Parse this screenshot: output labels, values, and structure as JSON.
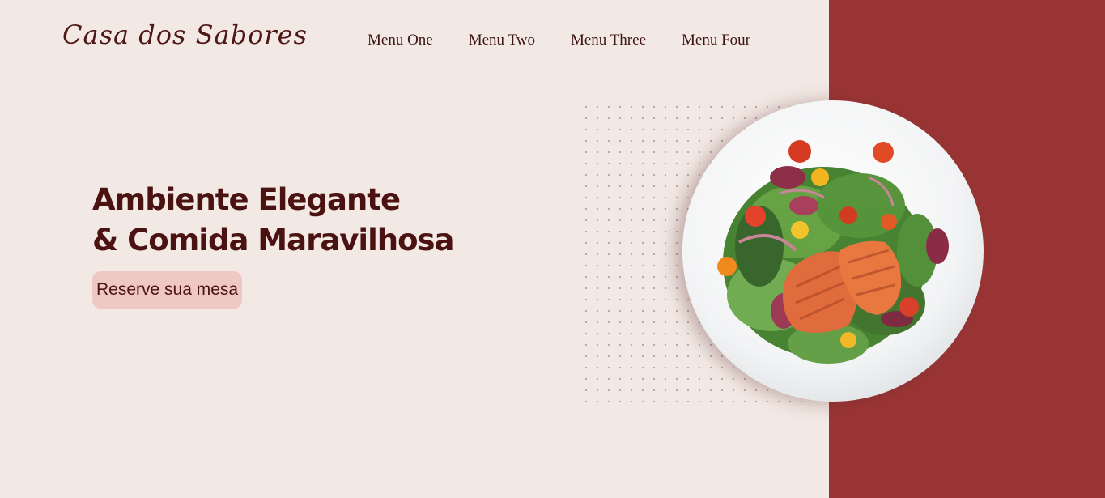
{
  "brand": {
    "logo": "Casa dos Sabores"
  },
  "nav": {
    "items": [
      {
        "label": "Menu One"
      },
      {
        "label": "Menu Two"
      },
      {
        "label": "Menu Three"
      },
      {
        "label": "Menu Four"
      }
    ]
  },
  "hero": {
    "title_line1": "Ambiente Elegante",
    "title_line2": "& Comida Maravilhosa",
    "cta_label": "Reserve sua mesa"
  },
  "colors": {
    "background": "#f3e9e4",
    "accent_panel": "#9b3535",
    "text_dark": "#4b1212",
    "button_bg": "#efc7c5"
  },
  "images": {
    "hero_dish": "salmon-salad-plate"
  }
}
